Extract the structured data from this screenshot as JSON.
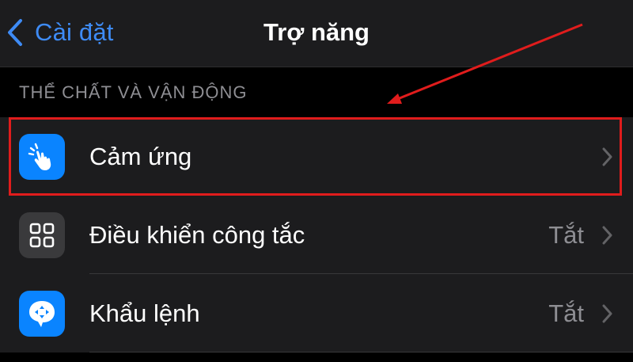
{
  "navbar": {
    "back_label": "Cài đặt",
    "title": "Trợ năng"
  },
  "section": {
    "header": "THỂ CHẤT VÀ VẬN ĐỘNG"
  },
  "rows": [
    {
      "label": "Cảm ứng",
      "value": "",
      "icon": "touch-hand-icon",
      "icon_color": "#0a84ff"
    },
    {
      "label": "Điều khiển công tắc",
      "value": "Tắt",
      "icon": "switch-control-grid-icon",
      "icon_color": "#3a3a3c"
    },
    {
      "label": "Khẩu lệnh",
      "value": "Tắt",
      "icon": "voice-control-icon",
      "icon_color": "#0a84ff"
    }
  ],
  "colors": {
    "accent": "#3e8bf5",
    "annotation": "#e01c1c",
    "background": "#000000",
    "row_background": "#1c1c1e"
  }
}
